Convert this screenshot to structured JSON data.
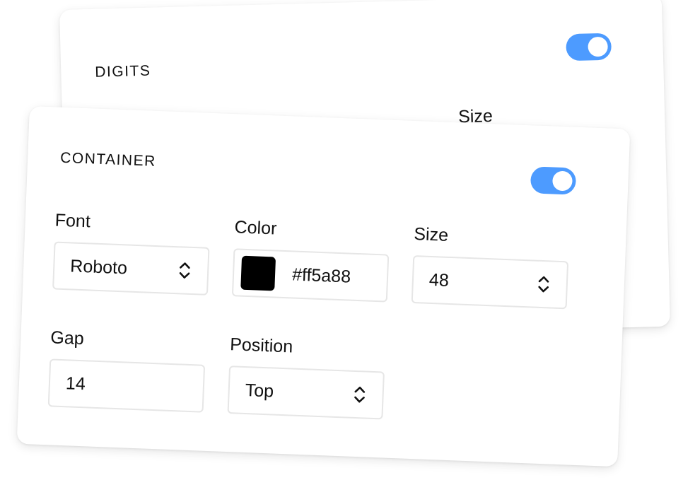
{
  "digits_panel": {
    "title": "DIGITS",
    "toggle_on": true,
    "partial_label": "Size"
  },
  "container_panel": {
    "title": "CONTAINER",
    "toggle_on": true,
    "font": {
      "label": "Font",
      "value": "Roboto"
    },
    "color": {
      "label": "Color",
      "value": "#ff5a88",
      "swatch_color": "#000000"
    },
    "size": {
      "label": "Size",
      "value": "48"
    },
    "gap": {
      "label": "Gap",
      "value": "14"
    },
    "position": {
      "label": "Position",
      "value": "Top"
    }
  },
  "colors": {
    "accent": "#4d9bff",
    "field_border": "#e6e6e6",
    "text": "#111111"
  },
  "icons": {
    "select_chevrons": "chevron-up-down-icon"
  }
}
